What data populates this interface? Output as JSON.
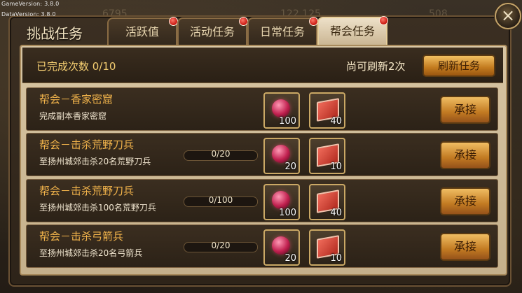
{
  "version": {
    "game": "GameVersion: 3.8.0",
    "data": "DataVersion: 3.8.0"
  },
  "background_numbers": [
    "6795",
    "122,125",
    "508"
  ],
  "window": {
    "title": "挑战任务",
    "close_icon": "×"
  },
  "tabs": [
    {
      "label": "活跃值",
      "active": false,
      "badge": true
    },
    {
      "label": "活动任务",
      "active": false,
      "badge": true
    },
    {
      "label": "日常任务",
      "active": false,
      "badge": true
    },
    {
      "label": "帮会任务",
      "active": true,
      "badge": true
    }
  ],
  "header": {
    "completed": "已完成次数 0/10",
    "refresh_left": "尚可刷新2次",
    "refresh_button": "刷新任务"
  },
  "tasks": [
    {
      "title": "帮会－香家密窟",
      "desc": "完成副本香家密窟",
      "progress_text": null,
      "progress": 0,
      "rewards": [
        {
          "icon": "gem-icon",
          "count": "100"
        },
        {
          "icon": "flag-icon",
          "count": "40"
        }
      ],
      "accept": "承接"
    },
    {
      "title": "帮会－击杀荒野刀兵",
      "desc": "至扬州城郊击杀20名荒野刀兵",
      "progress_text": "0/20",
      "progress": 0,
      "rewards": [
        {
          "icon": "gem-icon",
          "count": "20"
        },
        {
          "icon": "flag-icon",
          "count": "10"
        }
      ],
      "accept": "承接"
    },
    {
      "title": "帮会－击杀荒野刀兵",
      "desc": "至扬州城郊击杀100名荒野刀兵",
      "progress_text": "0/100",
      "progress": 0,
      "rewards": [
        {
          "icon": "gem-icon",
          "count": "100"
        },
        {
          "icon": "flag-icon",
          "count": "40"
        }
      ],
      "accept": "承接"
    },
    {
      "title": "帮会－击杀弓箭兵",
      "desc": "至扬州城郊击杀20名弓箭兵",
      "progress_text": "0/20",
      "progress": 0,
      "rewards": [
        {
          "icon": "gem-icon",
          "count": "20"
        },
        {
          "icon": "flag-icon",
          "count": "10"
        }
      ],
      "accept": "承接"
    }
  ]
}
